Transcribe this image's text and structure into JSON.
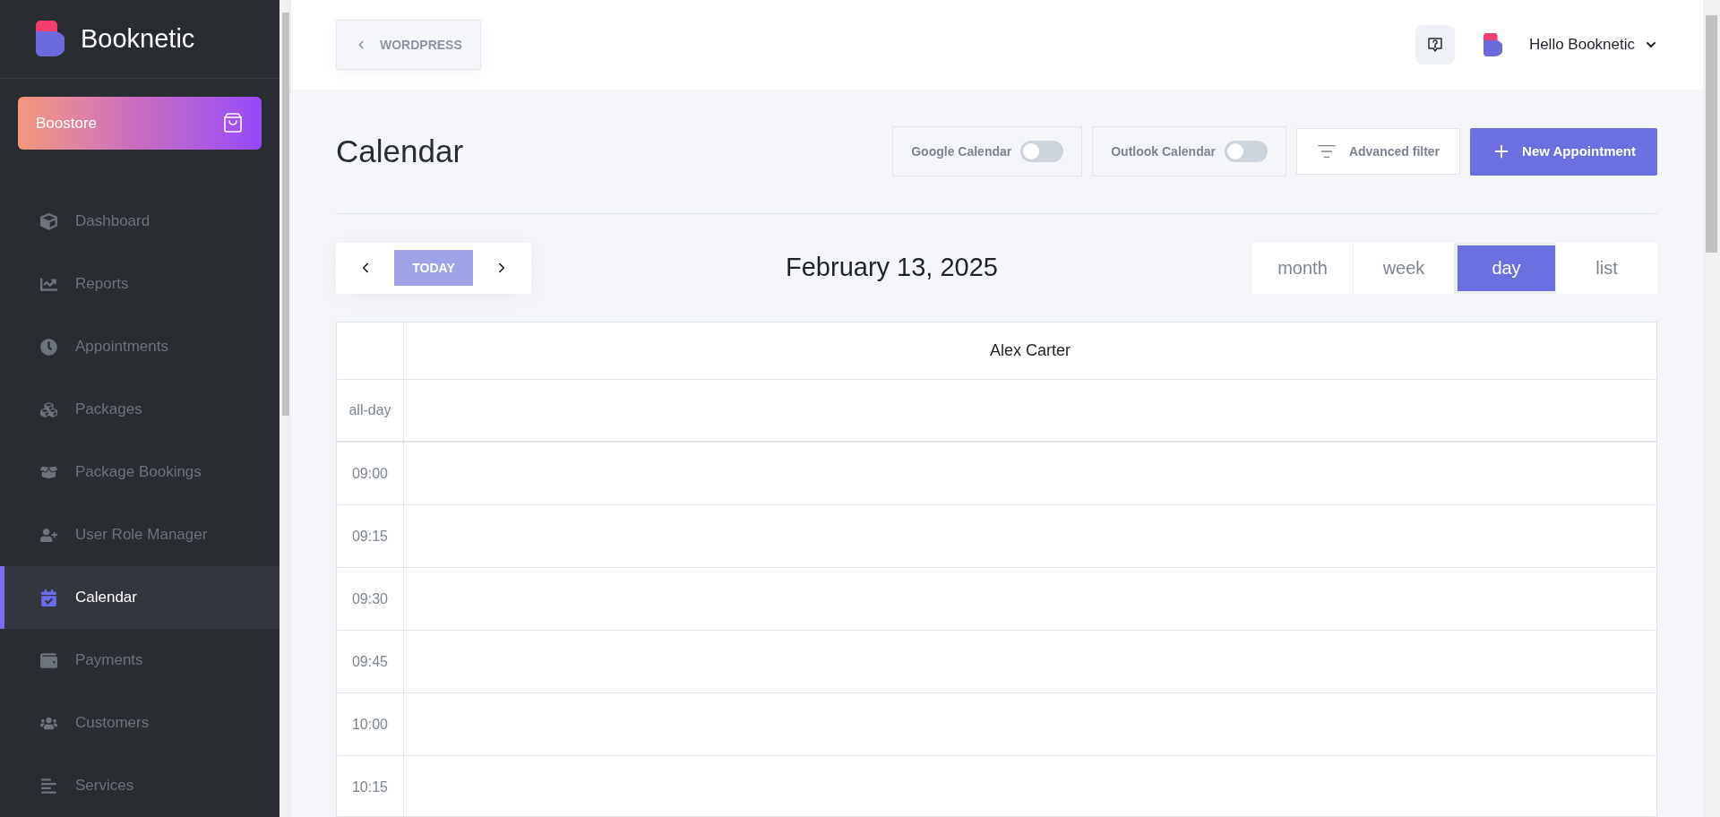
{
  "sidebar": {
    "brand": "Booknetic",
    "boostore": "Boostore",
    "items": [
      {
        "label": "Dashboard",
        "selected": false
      },
      {
        "label": "Reports",
        "selected": false
      },
      {
        "label": "Appointments",
        "selected": false
      },
      {
        "label": "Packages",
        "selected": false
      },
      {
        "label": "Package Bookings",
        "selected": false
      },
      {
        "label": "User Role Manager",
        "selected": false
      },
      {
        "label": "Calendar",
        "selected": true
      },
      {
        "label": "Payments",
        "selected": false
      },
      {
        "label": "Customers",
        "selected": false
      },
      {
        "label": "Services",
        "selected": false
      }
    ]
  },
  "topbar": {
    "back_link": "WORDPRESS",
    "user": "Hello Booknetic"
  },
  "page": {
    "title": "Calendar",
    "toggles": [
      {
        "label": "Google Calendar",
        "on": false
      },
      {
        "label": "Outlook Calendar",
        "on": false
      }
    ],
    "filter_button": "Advanced filter",
    "new_button": "New Appointment"
  },
  "calendar": {
    "today_button": "TODAY",
    "date": "February 13, 2025",
    "views": [
      {
        "label": "month",
        "selected": false
      },
      {
        "label": "week",
        "selected": false
      },
      {
        "label": "day",
        "selected": true
      },
      {
        "label": "list",
        "selected": false
      }
    ],
    "resource": "Alex Carter",
    "all_day": "all-day",
    "slots": [
      "09:00",
      "09:15",
      "09:30",
      "09:45",
      "10:00",
      "10:15"
    ]
  }
}
